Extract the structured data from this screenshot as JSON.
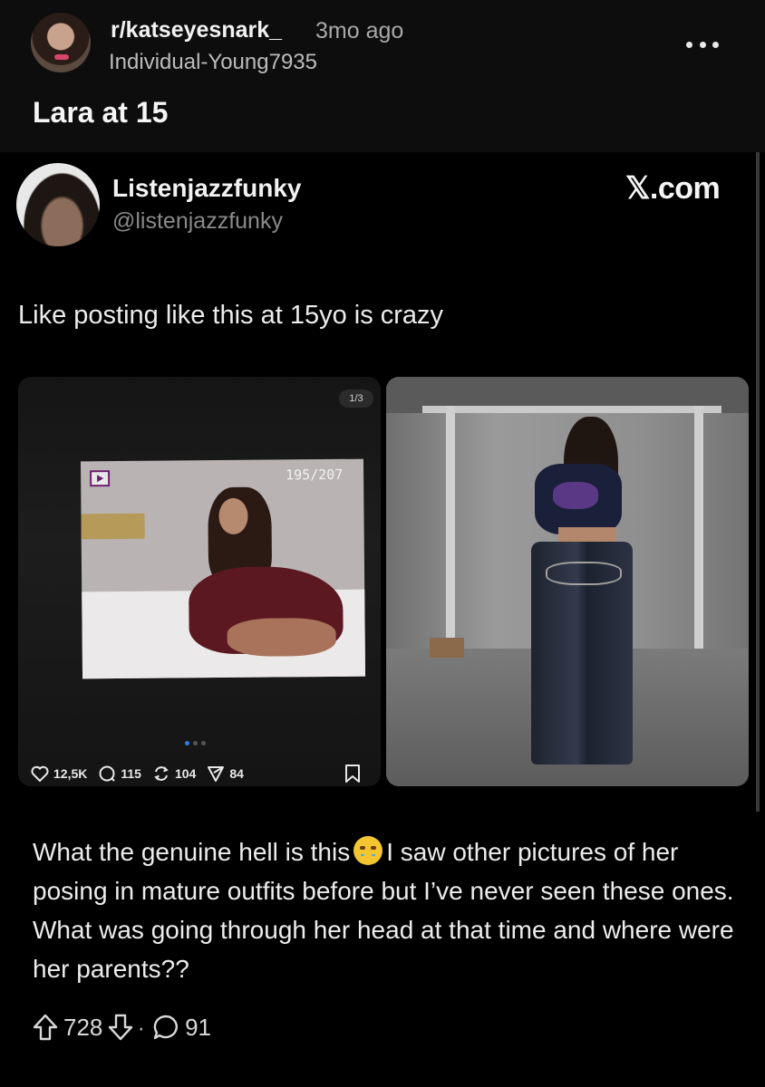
{
  "post": {
    "subreddit": "r/katseyesnark_",
    "time": "3mo ago",
    "username": "Individual-Young7935",
    "title": "Lara at 15",
    "body": "What the genuine hell is this 😭 I saw other pictures of her posing in mature outfits before but I've never seen these ones. What was going through her head at that time and where were her parents??",
    "body_before_emoji": "What the genuine hell is this",
    "body_after_emoji": "I saw other pictures of her posing in mature outfits before but I’ve never seen these ones. What was going through her head at that time and where were her parents??",
    "emoji": "loudly-crying-face",
    "upvotes": "728",
    "separator": "·",
    "comments": "91",
    "icons": {
      "more": "more-dots-icon",
      "upvote": "upvote-arrow-icon",
      "downvote": "downvote-arrow-icon",
      "comment": "comment-bubble-icon"
    }
  },
  "tweet": {
    "display_name": "Listenjazzfunky",
    "handle": "@listenjazzfunky",
    "source": "𝕏.com",
    "text": "Like posting like this at 15yo is crazy",
    "left_image": {
      "counter": "1/3",
      "camera_counter": "195/207",
      "stats": {
        "likes": "12,5K",
        "comments": "115",
        "reposts": "104",
        "shares": "84"
      }
    }
  },
  "colors": {
    "background": "#000000",
    "header_bg": "#0d0d0d",
    "text": "#ececec",
    "muted": "#a8a8a8",
    "accent_dot": "#2f7de1"
  }
}
